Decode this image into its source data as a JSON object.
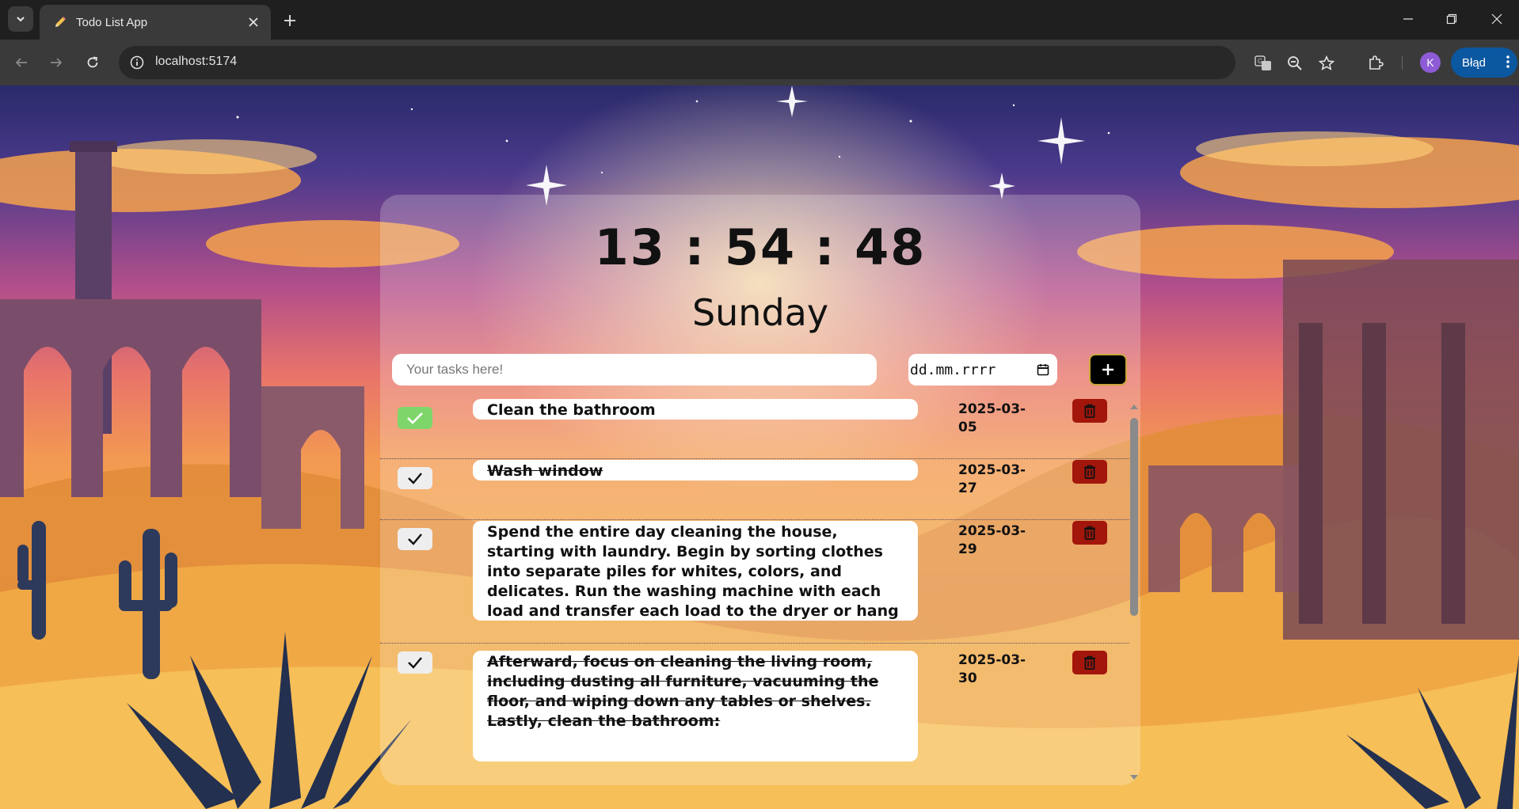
{
  "browser": {
    "tab_title": "Todo List App",
    "url": "localhost:5174",
    "profile_initial": "K",
    "error_label": "Błąd"
  },
  "app": {
    "time": "13 : 54 : 48",
    "day": "Sunday",
    "input_placeholder": "Your tasks here!",
    "date_placeholder": "dd.mm.rrrr",
    "add_label": "+"
  },
  "tasks": [
    {
      "text": "Clean the bathroom",
      "date": "2025-03-05",
      "completed": false,
      "check_state": "checked-green"
    },
    {
      "text": "Wash window",
      "date": "2025-03-27",
      "completed": true
    },
    {
      "text": "Spend the entire day cleaning the house, starting with laundry. Begin by sorting clothes into separate piles for whites, colors, and delicates. Run the washing machine with each load and transfer each load to the dryer or hang to dry as needed.",
      "date": "2025-03-29",
      "completed": false
    },
    {
      "text": "Afterward, focus on cleaning the living room, including dusting all furniture, vacuuming the floor, and wiping down any tables or shelves. Lastly, clean the bathroom:",
      "date": "2025-03-30",
      "completed": true
    }
  ],
  "colors": {
    "check_done": "#7ed66a",
    "delete": "#a3160c",
    "error_pill": "#0b57a0"
  }
}
